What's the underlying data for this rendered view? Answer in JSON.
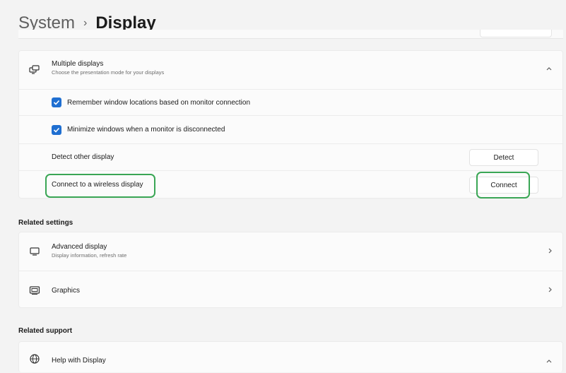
{
  "breadcrumb": {
    "parent": "System",
    "separator": "›",
    "current": "Display"
  },
  "multiple_displays": {
    "title": "Multiple displays",
    "subtitle": "Choose the presentation mode for your displays",
    "icon": "multiple-displays-icon",
    "expanded": true,
    "options": [
      {
        "label": "Remember window locations based on monitor connection",
        "checked": true
      },
      {
        "label": "Minimize windows when a monitor is disconnected",
        "checked": true
      }
    ],
    "detect": {
      "label": "Detect other display",
      "button": "Detect"
    },
    "connect": {
      "label": "Connect to a wireless display",
      "button": "Connect"
    }
  },
  "related_settings": {
    "heading": "Related settings",
    "items": [
      {
        "title": "Advanced display",
        "subtitle": "Display information, refresh rate",
        "icon": "monitor-icon"
      },
      {
        "title": "Graphics",
        "icon": "graphics-icon"
      }
    ]
  },
  "related_support": {
    "heading": "Related support",
    "items": [
      {
        "title": "Help with Display",
        "icon": "globe-icon",
        "expanded": true
      }
    ]
  },
  "colors": {
    "accent": "#1f6fd1",
    "highlight": "#3aa655",
    "background": "#f3f3f3",
    "card": "#fbfbfb"
  }
}
